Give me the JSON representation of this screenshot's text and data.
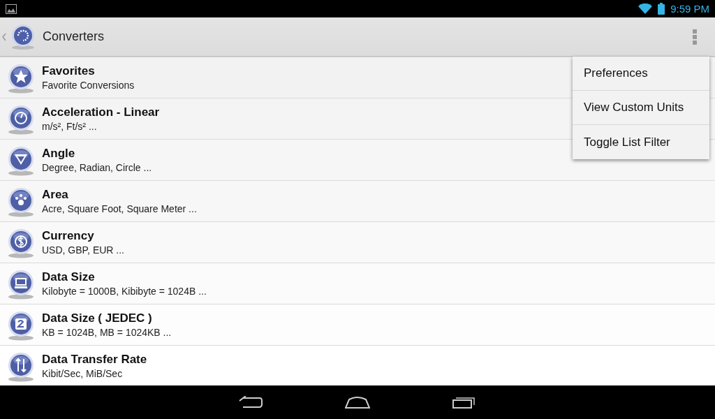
{
  "status_bar": {
    "time": "9:59 PM"
  },
  "action_bar": {
    "title": "Converters"
  },
  "list": [
    {
      "title": "Favorites",
      "subtitle": "Favorite Conversions"
    },
    {
      "title": "Acceleration - Linear",
      "subtitle": "m/s², Ft/s² ..."
    },
    {
      "title": "Angle",
      "subtitle": "Degree, Radian, Circle ..."
    },
    {
      "title": "Area",
      "subtitle": "Acre, Square Foot, Square Meter ..."
    },
    {
      "title": "Currency",
      "subtitle": "USD, GBP, EUR ..."
    },
    {
      "title": "Data Size",
      "subtitle": "Kilobyte = 1000B, Kibibyte = 1024B ..."
    },
    {
      "title": "Data Size ( JEDEC )",
      "subtitle": "KB = 1024B, MB = 1024KB ..."
    },
    {
      "title": "Data Transfer Rate",
      "subtitle": "Kibit/Sec, MiB/Sec"
    }
  ],
  "menu": [
    "Preferences",
    "View Custom Units",
    "Toggle List Filter"
  ]
}
